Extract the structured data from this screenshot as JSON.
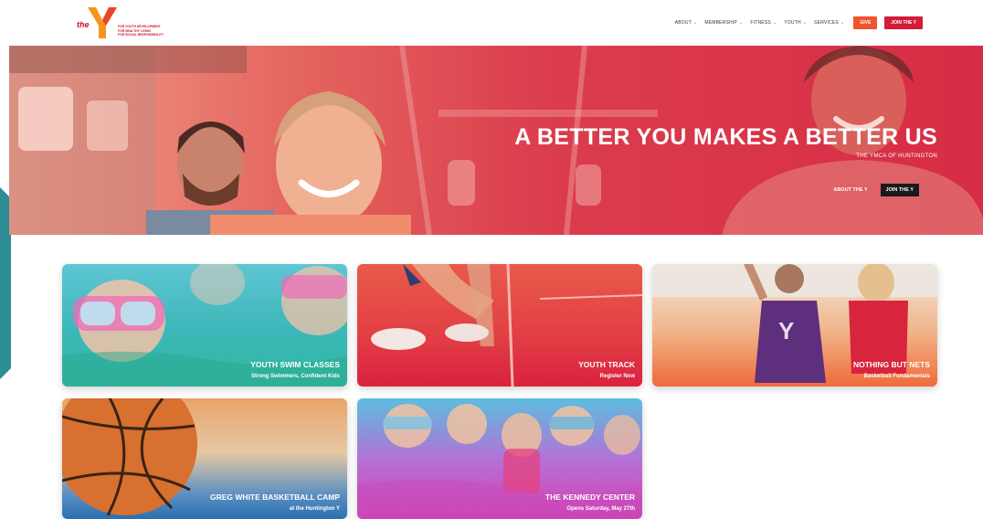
{
  "logo": {
    "the": "the",
    "tagline": [
      "FOR YOUTH DEVELOPMENT",
      "FOR HEALTHY LIVING",
      "FOR SOCIAL RESPONSIBILITY"
    ]
  },
  "nav": {
    "items": [
      {
        "label": "ABOUT",
        "chevron": "⌄"
      },
      {
        "label": "MEMBERSHIP",
        "chevron": "⌄"
      },
      {
        "label": "FITNESS",
        "chevron": "⌄"
      },
      {
        "label": "YOUTH",
        "chevron": "⌄"
      },
      {
        "label": "SERVICES",
        "chevron": "⌄"
      }
    ],
    "give_label": "GIVE",
    "join_label": "JOIN THE Y"
  },
  "hero": {
    "title": "A BETTER YOU MAKES A BETTER US",
    "subtitle": "THE YMCA OF HUNTINGTON",
    "about_label": "ABOUT THE Y",
    "join_label": "JOIN THE Y"
  },
  "cards": [
    {
      "title": "YOUTH SWIM CLASSES",
      "subtitle": "Strong Swimmers, Confident Kids"
    },
    {
      "title": "YOUTH TRACK",
      "subtitle": "Register Now"
    },
    {
      "title": "NOTHING BUT NETS",
      "subtitle": "Basketball Fundamentals"
    },
    {
      "title": "GREG WHITE BASKETBALL CAMP",
      "subtitle": "at the Huntington Y"
    },
    {
      "title": "THE KENNEDY CENTER",
      "subtitle": "Opens Saturday, May 27th"
    }
  ],
  "colors": {
    "brand_red": "#d31b3a",
    "give_orange": "#f0542c",
    "side_tab": "#2e8c97"
  }
}
